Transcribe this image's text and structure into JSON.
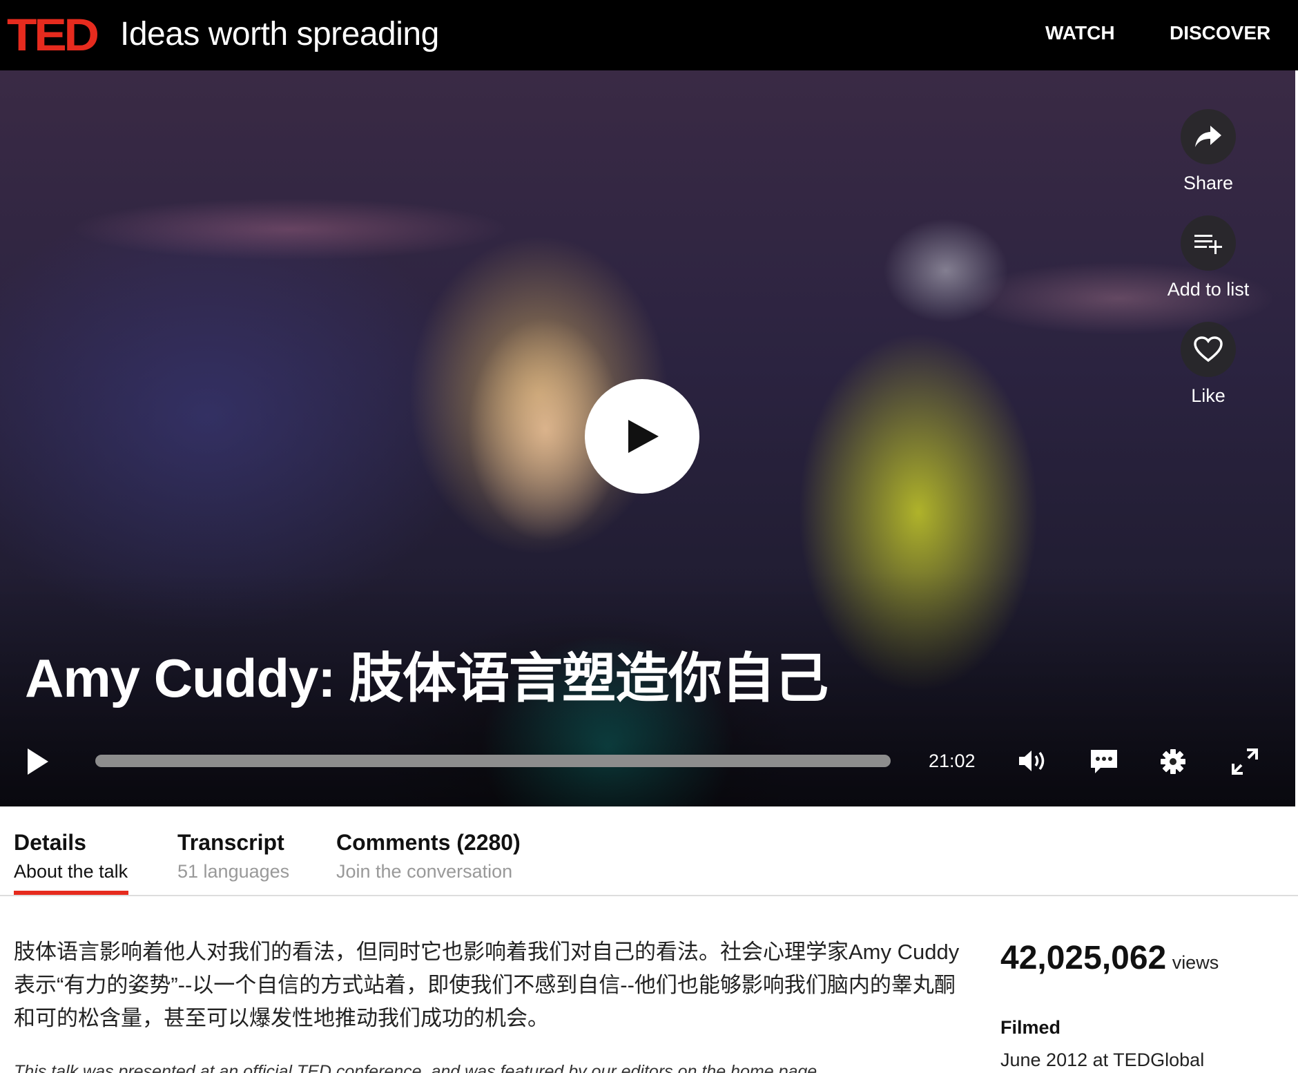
{
  "header": {
    "logo": "TED",
    "tagline": "Ideas worth spreading",
    "nav": [
      "WATCH",
      "DISCOVER"
    ]
  },
  "player": {
    "title": "Amy Cuddy: 肢体语言塑造你自己",
    "actions": [
      {
        "label": "Share",
        "icon": "share-icon"
      },
      {
        "label": "Add to list",
        "icon": "add-to-list-icon"
      },
      {
        "label": "Like",
        "icon": "heart-icon"
      }
    ],
    "duration": "21:02",
    "progress": 0,
    "accent": "#e62b1e"
  },
  "tabs": [
    {
      "title": "Details",
      "subtitle": "About the talk",
      "active": true
    },
    {
      "title": "Transcript",
      "subtitle": "51 languages",
      "active": false
    },
    {
      "title": "Comments (2280)",
      "subtitle": "Join the conversation",
      "active": false
    }
  ],
  "details": {
    "description": "肢体语言影响着他人对我们的看法，但同时它也影响着我们对自己的看法。社会心理学家Amy Cuddy表示“有力的姿势”--以一个自信的方式站着，即使我们不感到自信--他们也能够影响我们脑内的睾丸酮和可的松含量，甚至可以爆发性地推动我们成功的机会。",
    "note": "This talk was presented at an official TED conference, and was featured by our editors on the home page.",
    "views_count": "42,025,062",
    "views_label": "views",
    "filmed_label": "Filmed",
    "filmed_value": "June 2012 at TEDGlobal"
  }
}
